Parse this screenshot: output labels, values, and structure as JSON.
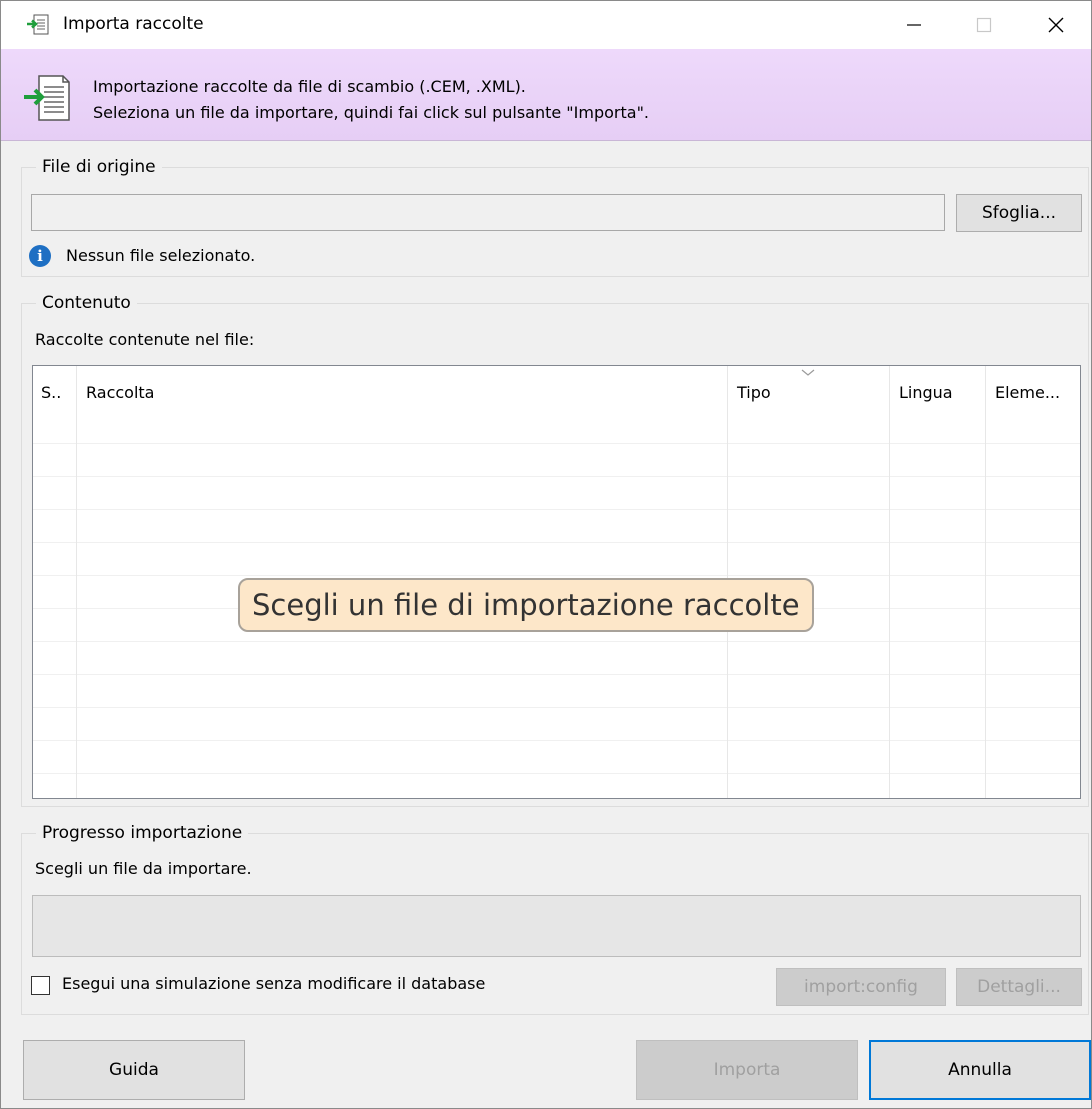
{
  "window": {
    "title": "Importa raccolte"
  },
  "banner": {
    "line1": "Importazione raccolte da file di scambio (.CEM, .XML).",
    "line2": "Seleziona un file da importare, quindi fai click sul pulsante \"Importa\"."
  },
  "source_group": {
    "label": "File di origine",
    "path_value": "",
    "browse_label": "Sfoglia...",
    "info_text": "Nessun file selezionato."
  },
  "content_group": {
    "label": "Contenuto",
    "caption": "Raccolte contenute nel file:",
    "columns": [
      "S..",
      "Raccolta",
      "Tipo",
      "Lingua",
      "Eleme..."
    ],
    "rows": [],
    "empty_message": "Scegli un file di importazione raccolte"
  },
  "progress_group": {
    "label": "Progresso importazione",
    "caption": "Scegli un file da importare.",
    "progress_fraction": 0,
    "simulate_label": "Esegui una simulazione senza modificare il database",
    "simulate_checked": false,
    "config_label": "import:config",
    "details_label": "Dettagli..."
  },
  "footer": {
    "help_label": "Guida",
    "import_label": "Importa",
    "cancel_label": "Annulla"
  },
  "colors": {
    "banner_bg": "#eed9fb",
    "empty_msg_bg": "#fde7c9",
    "info_blue": "#1e6fc3",
    "default_button_border": "#0078d7"
  }
}
